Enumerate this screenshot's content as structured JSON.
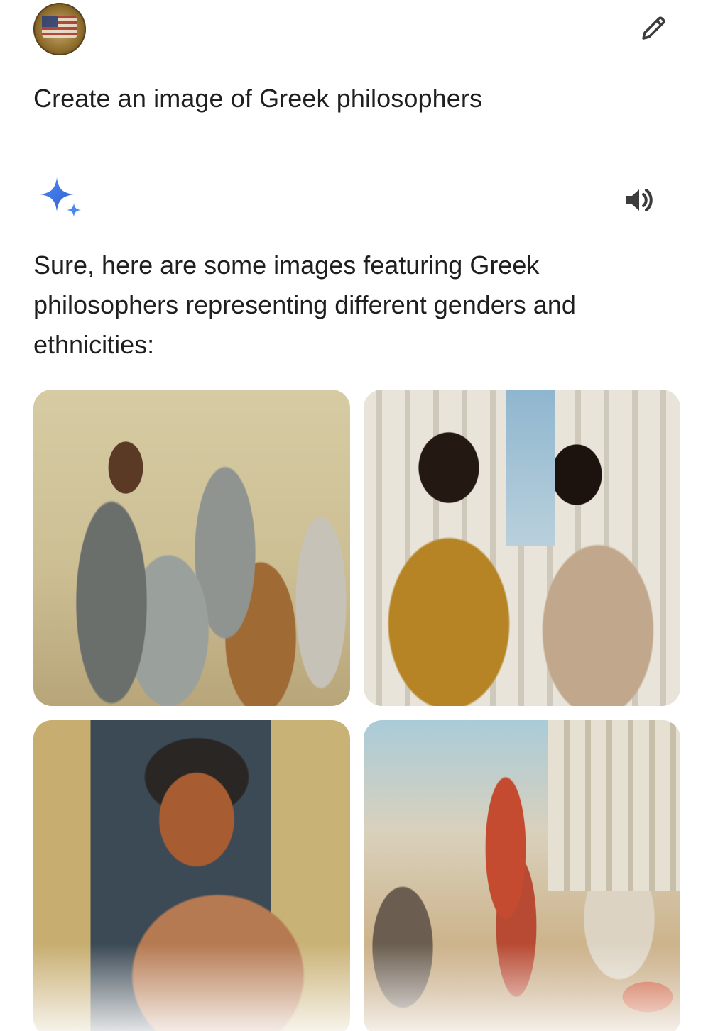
{
  "user_message": {
    "avatar_icon": "user-avatar-coin-icon",
    "text": "Create an image of Greek philosophers",
    "edit_icon": "pencil-edit-icon"
  },
  "assistant_message": {
    "logo_icon": "gemini-sparkle-icon",
    "speaker_icon": "speaker-volume-icon",
    "text": "Sure, here are some images featuring Greek philosophers representing different genders and ethnicities:"
  },
  "images": [
    {
      "id": "image-1"
    },
    {
      "id": "image-2"
    },
    {
      "id": "image-3"
    },
    {
      "id": "image-4"
    }
  ],
  "colors": {
    "sparkle_blue": "#4285f4",
    "text": "#1f1f1f",
    "icon": "#444746"
  }
}
